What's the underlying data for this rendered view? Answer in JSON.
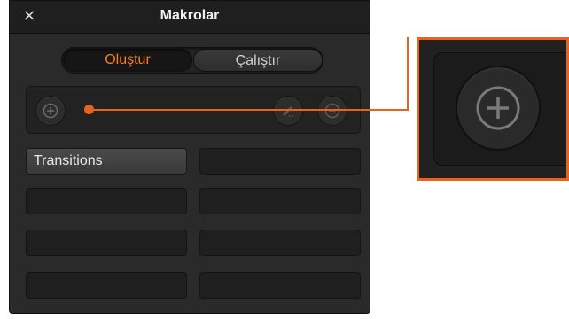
{
  "window": {
    "title": "Makrolar",
    "close_glyph": "×"
  },
  "tabs": [
    {
      "label": "Oluştur",
      "active": true
    },
    {
      "label": "Çalıştır",
      "active": false
    }
  ],
  "toolbar": {
    "add_icon": "add-circle-icon",
    "edit_icon": "pencil-icon",
    "remove_icon": "remove-circle-icon"
  },
  "macros": [
    "Transitions",
    "",
    "",
    "",
    "",
    "",
    "",
    ""
  ],
  "colors": {
    "accent": "#ff7a22",
    "callout": "#e8641e",
    "panel": "#2a2a2a"
  },
  "callout": {
    "target": "add-button",
    "zoom_icon": "add-circle-icon"
  }
}
